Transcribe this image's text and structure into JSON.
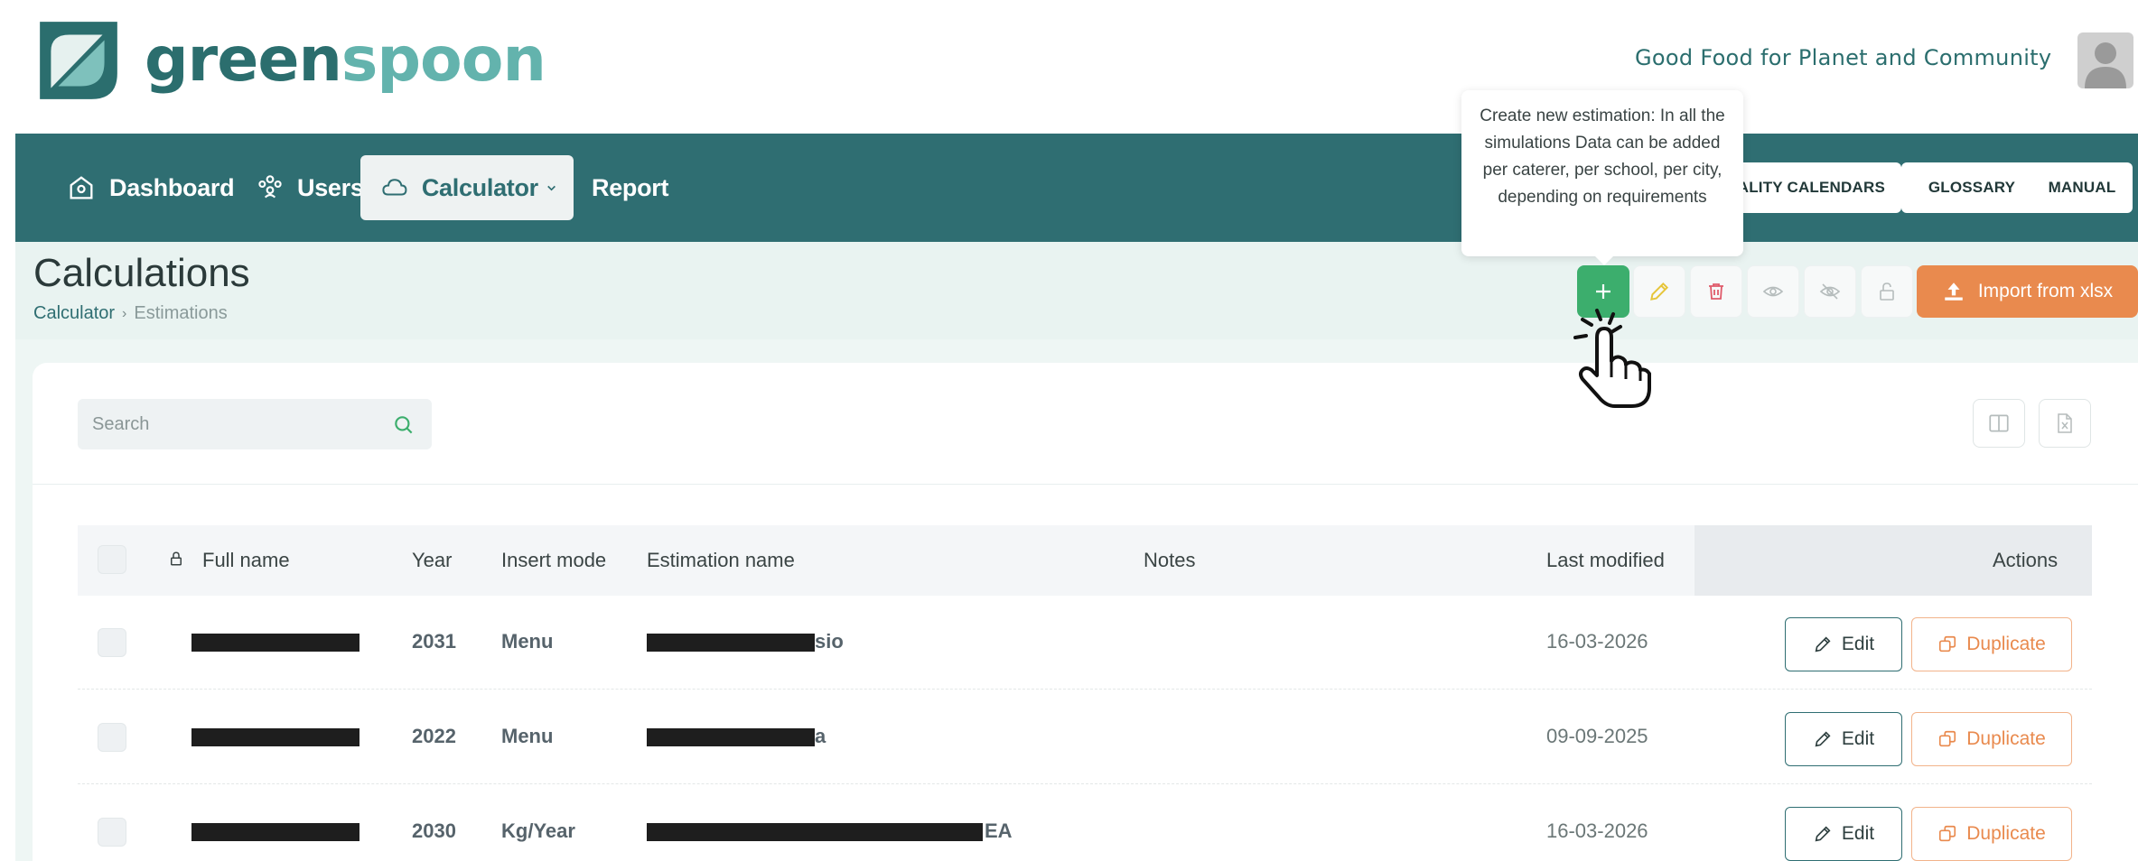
{
  "brand": {
    "logo_text_dark": "green",
    "logo_text_light": "spoon",
    "tagline": "Good Food for Planet and Community"
  },
  "navbar": {
    "items": [
      {
        "label": "Dashboard",
        "icon": "home-icon"
      },
      {
        "label": "Users",
        "icon": "users-icon"
      },
      {
        "label": "Calculator",
        "icon": "cloud-icon",
        "active": true
      },
      {
        "label": "Report"
      }
    ],
    "buttons": {
      "quality_calendars": "QUALITY CALENDARS",
      "glossary": "GLOSSARY",
      "manual": "MANUAL"
    }
  },
  "page": {
    "title": "Calculations",
    "breadcrumb": [
      "Calculator",
      "Estimations"
    ]
  },
  "toolbar": {
    "import_label": "Import from xlsx",
    "tooltip": "Create new estimation: In all the simulations Data can be added per caterer, per school, per city, depending on requirements"
  },
  "search": {
    "placeholder": "Search"
  },
  "table": {
    "columns": {
      "full_name": "Full name",
      "year": "Year",
      "insert_mode": "Insert mode",
      "estimation_name": "Estimation name",
      "notes": "Notes",
      "last_modified": "Last modified",
      "actions": "Actions"
    },
    "rows": [
      {
        "year": "2031",
        "insert_mode": "Menu",
        "estimation_suffix": "sio",
        "last_modified": "16-03-2026"
      },
      {
        "year": "2022",
        "insert_mode": "Menu",
        "estimation_suffix": "a",
        "last_modified": "09-09-2025"
      },
      {
        "year": "2030",
        "insert_mode": "Kg/Year",
        "estimation_suffix": "EA",
        "last_modified": "16-03-2026"
      }
    ],
    "edit_label": "Edit",
    "duplicate_label": "Duplicate"
  },
  "colors": {
    "primary": "#2f6e72",
    "accent_green": "#3cae6d",
    "accent_orange": "#e98a4e"
  }
}
